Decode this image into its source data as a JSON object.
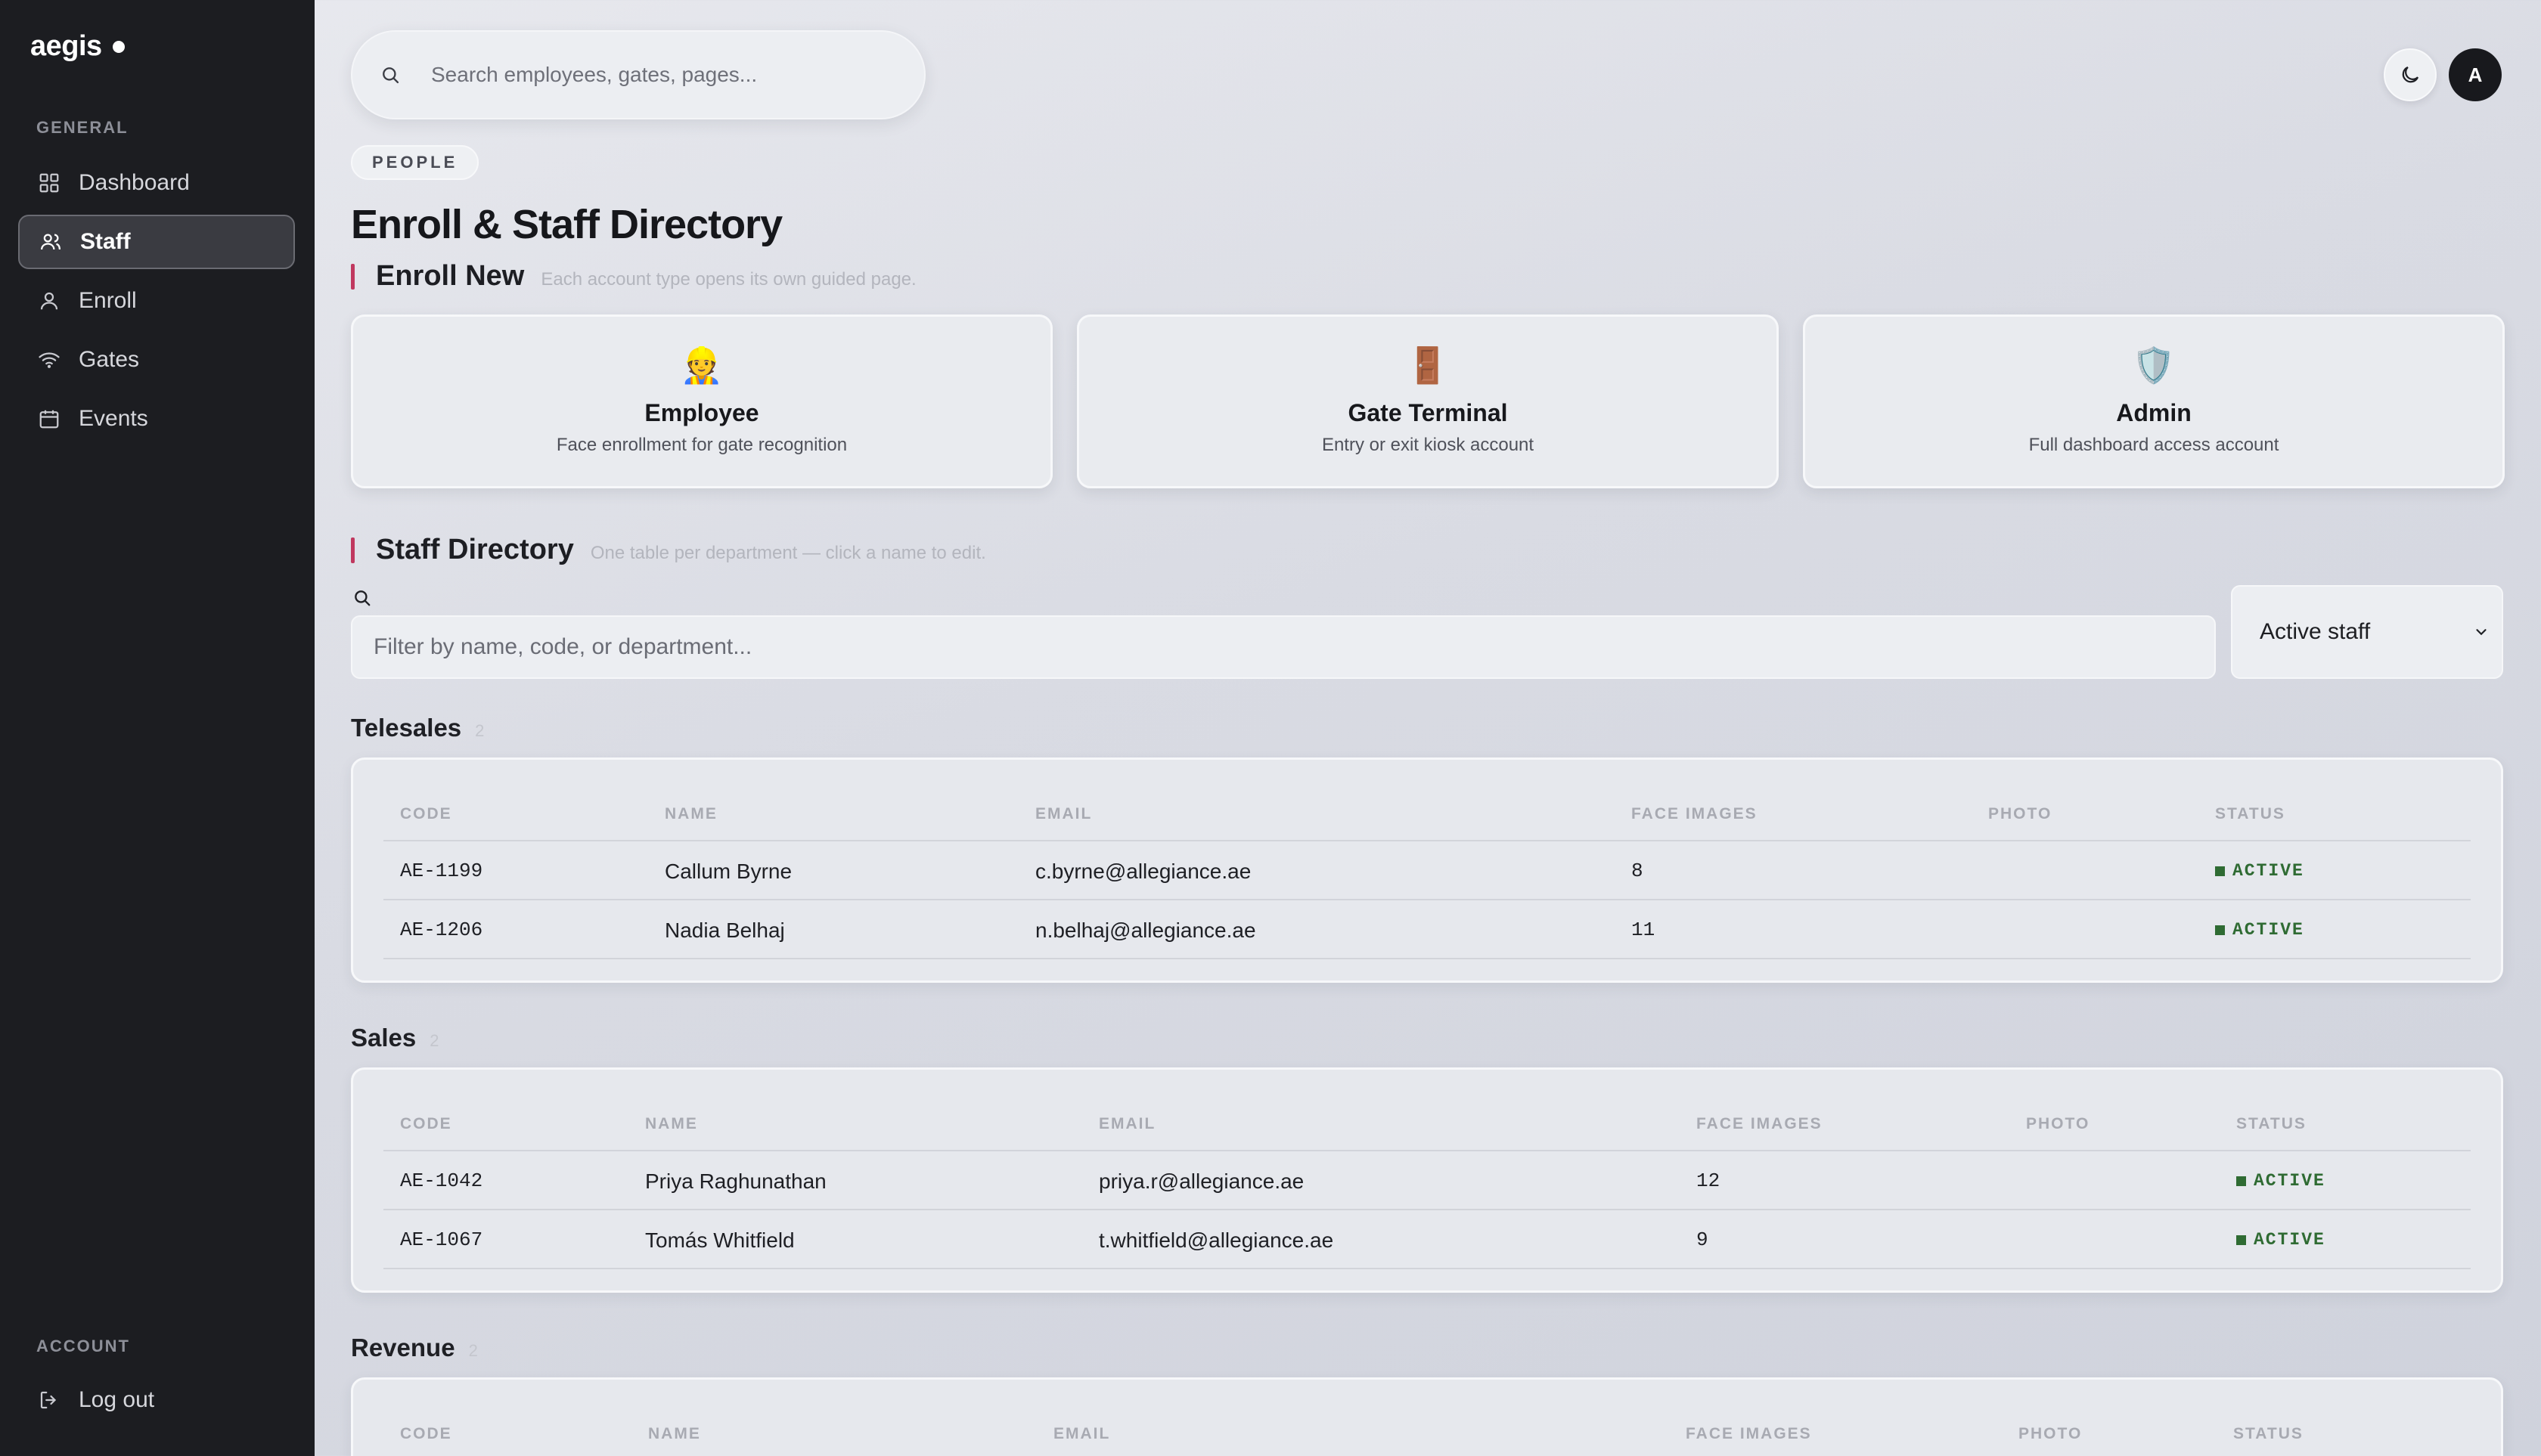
{
  "brand": {
    "name": "aegis"
  },
  "sidebar": {
    "general_label": "GENERAL",
    "items": [
      {
        "label": "Dashboard",
        "icon": "grid-icon",
        "active": false
      },
      {
        "label": "Staff",
        "icon": "users-icon",
        "active": true
      },
      {
        "label": "Enroll",
        "icon": "user-icon",
        "active": false
      },
      {
        "label": "Gates",
        "icon": "wifi-icon",
        "active": false
      },
      {
        "label": "Events",
        "icon": "calendar-icon",
        "active": false
      }
    ],
    "account_label": "ACCOUNT",
    "logout_label": "Log out"
  },
  "topbar": {
    "search_placeholder": "Search employees, gates, pages...",
    "avatar_initial": "A"
  },
  "page": {
    "eyebrow": "PEOPLE",
    "title": "Enroll & Staff Directory"
  },
  "enroll": {
    "heading": "Enroll New",
    "subheading": "Each account type opens its own guided page.",
    "cards": [
      {
        "emoji": "👷",
        "title": "Employee",
        "subtitle": "Face enrollment for gate recognition"
      },
      {
        "emoji": "🚪",
        "title": "Gate Terminal",
        "subtitle": "Entry or exit kiosk account"
      },
      {
        "emoji": "🛡️",
        "title": "Admin",
        "subtitle": "Full dashboard access account"
      }
    ]
  },
  "directory": {
    "heading": "Staff Directory",
    "subheading": "One table per department — click a name to edit.",
    "filter_placeholder": "Filter by name, code, or department...",
    "status_filter": "Active staff",
    "columns": [
      "CODE",
      "NAME",
      "EMAIL",
      "FACE IMAGES",
      "PHOTO",
      "STATUS"
    ],
    "departments": [
      {
        "name": "Telesales",
        "count": "2",
        "rows": [
          {
            "code": "AE-1199",
            "name": "Callum Byrne",
            "email": "c.byrne@allegiance.ae",
            "faces": "8",
            "status": "ACTIVE"
          },
          {
            "code": "AE-1206",
            "name": "Nadia Belhaj",
            "email": "n.belhaj@allegiance.ae",
            "faces": "11",
            "status": "ACTIVE"
          }
        ]
      },
      {
        "name": "Sales",
        "count": "2",
        "rows": [
          {
            "code": "AE-1042",
            "name": "Priya Raghunathan",
            "email": "priya.r@allegiance.ae",
            "faces": "12",
            "status": "ACTIVE"
          },
          {
            "code": "AE-1067",
            "name": "Tomás Whitfield",
            "email": "t.whitfield@allegiance.ae",
            "faces": "9",
            "status": "ACTIVE"
          }
        ]
      },
      {
        "name": "Revenue",
        "count": "2",
        "rows": []
      }
    ]
  },
  "colors": {
    "sidebar_bg": "#1c1d21",
    "accent": "#c0385f",
    "status_active": "#2f6b33"
  }
}
